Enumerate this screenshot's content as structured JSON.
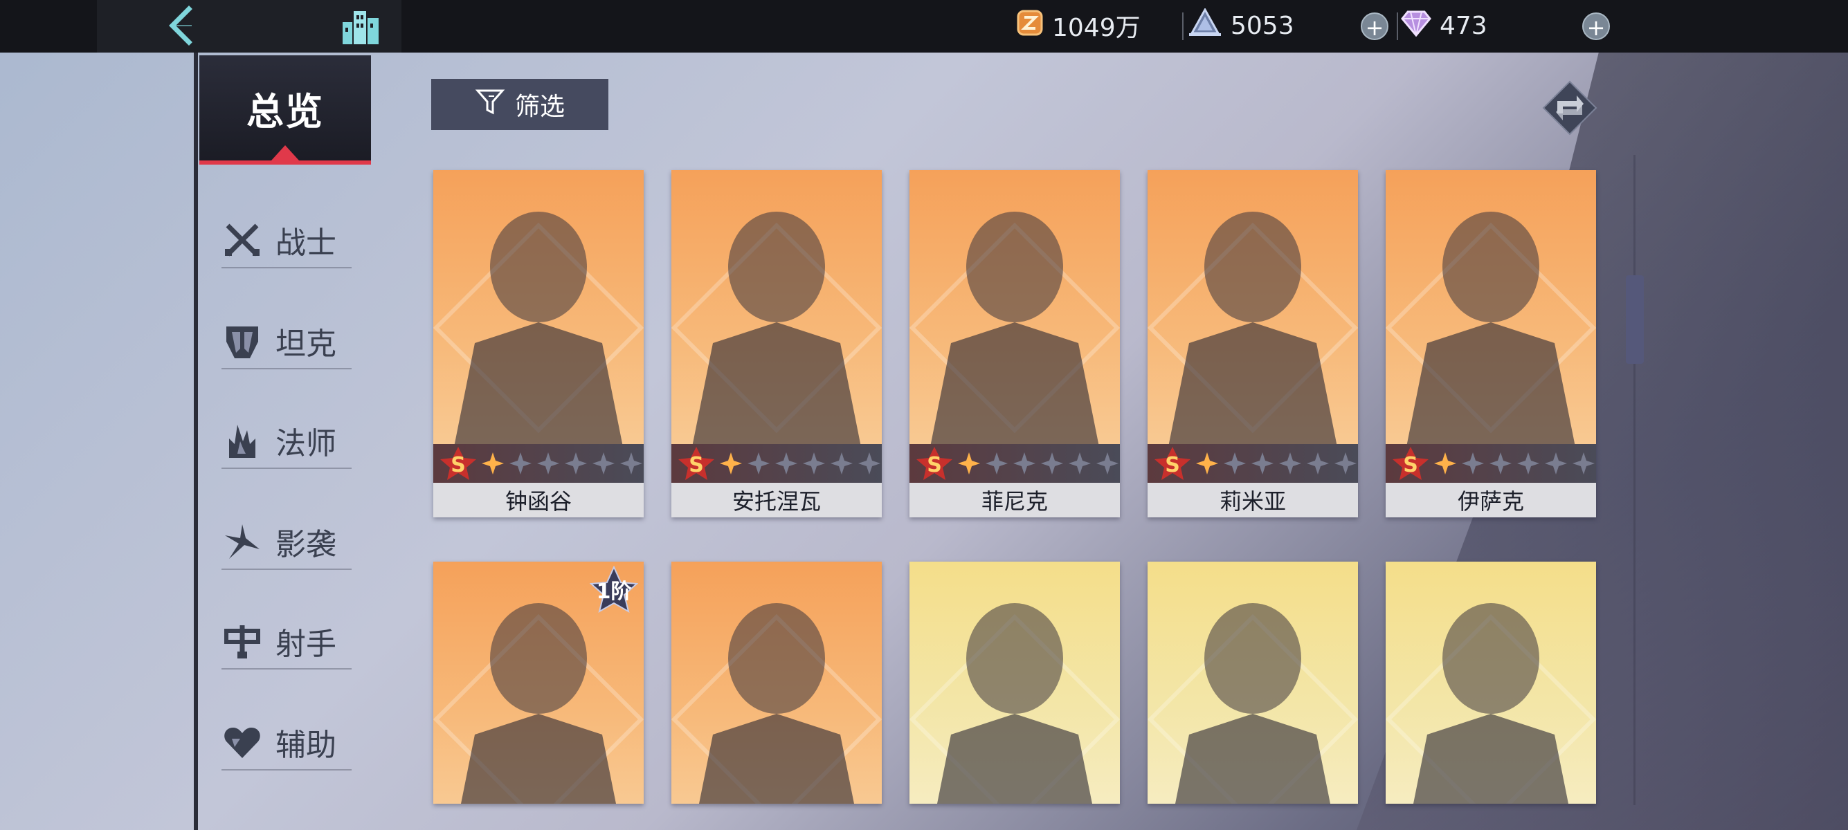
{
  "topbar": {
    "back_icon": "back-arrow-icon",
    "home_icon": "city-buildings-icon",
    "currencies": [
      {
        "icon": "gold-coin-icon",
        "value": "1049万"
      },
      {
        "icon": "crystal-icon",
        "value": "5053"
      },
      {
        "icon": "diamond-gem-icon",
        "value": "473"
      }
    ],
    "plus_label": "+"
  },
  "sidebar": {
    "overview": "总览",
    "categories": [
      {
        "icon": "crossed-swords-icon",
        "label": "战士"
      },
      {
        "icon": "tank-helmet-icon",
        "label": "坦克"
      },
      {
        "icon": "mage-flame-icon",
        "label": "法师"
      },
      {
        "icon": "shuriken-icon",
        "label": "影袭"
      },
      {
        "icon": "archer-bow-icon",
        "label": "射手"
      },
      {
        "icon": "heart-support-icon",
        "label": "辅助"
      }
    ]
  },
  "toolbar": {
    "filter_label": "筛选",
    "filter_icon": "funnel-icon",
    "refresh_icon": "refresh-arrows-icon"
  },
  "heroes": [
    {
      "name": "钟函谷",
      "grade": "S",
      "bg": "orange",
      "stars": 1
    },
    {
      "name": "安托涅瓦",
      "grade": "S",
      "bg": "orange",
      "stars": 1
    },
    {
      "name": "菲尼克",
      "grade": "S",
      "bg": "orange",
      "stars": 1
    },
    {
      "name": "莉米亚",
      "grade": "S",
      "bg": "orange",
      "stars": 1
    },
    {
      "name": "伊萨克",
      "grade": "S",
      "bg": "orange",
      "stars": 1
    },
    {
      "bg": "orange",
      "tier": "1阶"
    },
    {
      "bg": "orange"
    },
    {
      "bg": "yellow"
    },
    {
      "bg": "yellow"
    },
    {
      "bg": "yellow"
    }
  ],
  "colors": {
    "accent_red": "#e0394a",
    "topbar": "#14151a",
    "card_orange": "#f5a15a",
    "card_yellow": "#f4de8a"
  }
}
